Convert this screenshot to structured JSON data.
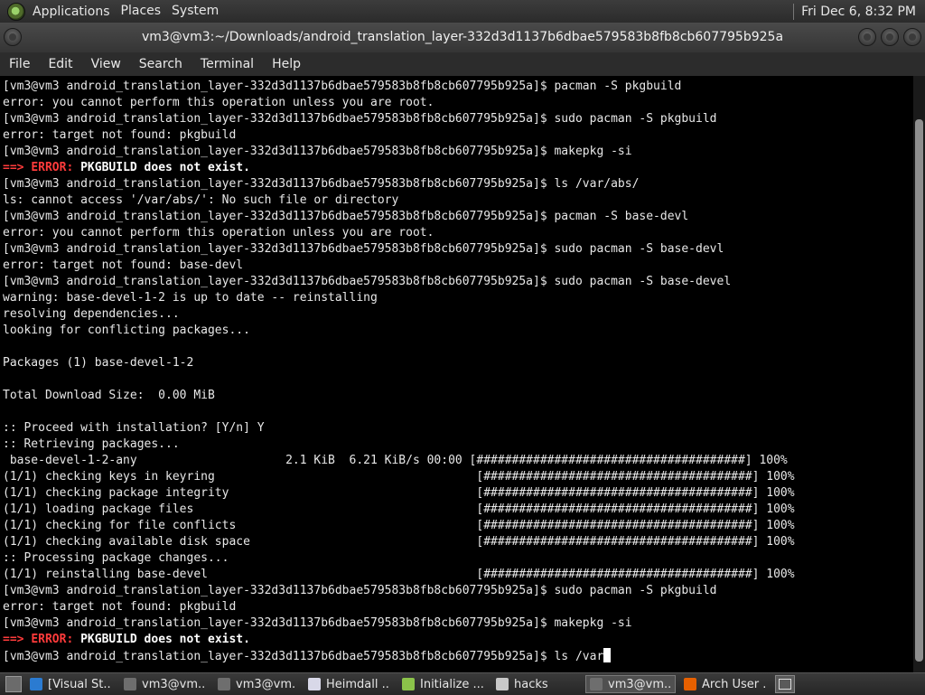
{
  "top_panel": {
    "menus": [
      "Applications",
      "Places",
      "System"
    ],
    "clock": "Fri Dec 6, 8:32 PM"
  },
  "window": {
    "title": "vm3@vm3:~/Downloads/android_translation_layer-332d3d1137b6dbae579583b8fb8cb607795b925a"
  },
  "menubar": [
    "File",
    "Edit",
    "View",
    "Search",
    "Terminal",
    "Help"
  ],
  "terminal": {
    "lines": [
      {
        "type": "plain",
        "text": "[vm3@vm3 android_translation_layer-332d3d1137b6dbae579583b8fb8cb607795b925a]$ pacman -S pkgbuild"
      },
      {
        "type": "plain",
        "text": "error: you cannot perform this operation unless you are root."
      },
      {
        "type": "plain",
        "text": "[vm3@vm3 android_translation_layer-332d3d1137b6dbae579583b8fb8cb607795b925a]$ sudo pacman -S pkgbuild"
      },
      {
        "type": "plain",
        "text": "error: target not found: pkgbuild"
      },
      {
        "type": "plain",
        "text": "[vm3@vm3 android_translation_layer-332d3d1137b6dbae579583b8fb8cb607795b925a]$ makepkg -si"
      },
      {
        "type": "error",
        "arrow": "==>",
        "label": "ERROR:",
        "text": "PKGBUILD does not exist."
      },
      {
        "type": "plain",
        "text": "[vm3@vm3 android_translation_layer-332d3d1137b6dbae579583b8fb8cb607795b925a]$ ls /var/abs/"
      },
      {
        "type": "plain",
        "text": "ls: cannot access '/var/abs/': No such file or directory"
      },
      {
        "type": "plain",
        "text": "[vm3@vm3 android_translation_layer-332d3d1137b6dbae579583b8fb8cb607795b925a]$ pacman -S base-devl"
      },
      {
        "type": "plain",
        "text": "error: you cannot perform this operation unless you are root."
      },
      {
        "type": "plain",
        "text": "[vm3@vm3 android_translation_layer-332d3d1137b6dbae579583b8fb8cb607795b925a]$ sudo pacman -S base-devl"
      },
      {
        "type": "plain",
        "text": "error: target not found: base-devl"
      },
      {
        "type": "plain",
        "text": "[vm3@vm3 android_translation_layer-332d3d1137b6dbae579583b8fb8cb607795b925a]$ sudo pacman -S base-devel"
      },
      {
        "type": "plain",
        "text": "warning: base-devel-1-2 is up to date -- reinstalling"
      },
      {
        "type": "plain",
        "text": "resolving dependencies..."
      },
      {
        "type": "plain",
        "text": "looking for conflicting packages..."
      },
      {
        "type": "plain",
        "text": ""
      },
      {
        "type": "plain",
        "text": "Packages (1) base-devel-1-2"
      },
      {
        "type": "plain",
        "text": ""
      },
      {
        "type": "plain",
        "text": "Total Download Size:  0.00 MiB"
      },
      {
        "type": "plain",
        "text": ""
      },
      {
        "type": "plain",
        "text": ":: Proceed with installation? [Y/n] Y"
      },
      {
        "type": "plain",
        "text": ":: Retrieving packages..."
      },
      {
        "type": "plain",
        "text": " base-devel-1-2-any                     2.1 KiB  6.21 KiB/s 00:00 [######################################] 100%"
      },
      {
        "type": "plain",
        "text": "(1/1) checking keys in keyring                                     [######################################] 100%"
      },
      {
        "type": "plain",
        "text": "(1/1) checking package integrity                                   [######################################] 100%"
      },
      {
        "type": "plain",
        "text": "(1/1) loading package files                                        [######################################] 100%"
      },
      {
        "type": "plain",
        "text": "(1/1) checking for file conflicts                                  [######################################] 100%"
      },
      {
        "type": "plain",
        "text": "(1/1) checking available disk space                                [######################################] 100%"
      },
      {
        "type": "plain",
        "text": ":: Processing package changes..."
      },
      {
        "type": "plain",
        "text": "(1/1) reinstalling base-devel                                      [######################################] 100%"
      },
      {
        "type": "plain",
        "text": "[vm3@vm3 android_translation_layer-332d3d1137b6dbae579583b8fb8cb607795b925a]$ sudo pacman -S pkgbuild"
      },
      {
        "type": "plain",
        "text": "error: target not found: pkgbuild"
      },
      {
        "type": "plain",
        "text": "[vm3@vm3 android_translation_layer-332d3d1137b6dbae579583b8fb8cb607795b925a]$ makepkg -si"
      },
      {
        "type": "error",
        "arrow": "==>",
        "label": "ERROR:",
        "text": "PKGBUILD does not exist."
      },
      {
        "type": "prompt",
        "text": "[vm3@vm3 android_translation_layer-332d3d1137b6dbae579583b8fb8cb607795b925a]$ ls /var"
      }
    ]
  },
  "taskbar": {
    "items": [
      {
        "label": "[Visual St...",
        "icon": "vscode-icon",
        "color": "#2b7bd1"
      },
      {
        "label": "vm3@vm...",
        "icon": "terminal-icon",
        "color": "#6e6e6e"
      },
      {
        "label": "vm3@vm...",
        "icon": "terminal-icon",
        "color": "#6e6e6e"
      },
      {
        "label": "Heimdall ...",
        "icon": "window-icon",
        "color": "#d8d8e8"
      },
      {
        "label": "Initialize ...",
        "icon": "android-icon",
        "color": "#8bc34a"
      },
      {
        "label": "hacks",
        "icon": "folder-icon",
        "color": "#c8c8c8"
      },
      {
        "label": "vm3@vm...",
        "icon": "terminal-icon",
        "color": "#6e6e6e",
        "active": true
      },
      {
        "label": "Arch User ...",
        "icon": "firefox-icon",
        "color": "#e66000"
      }
    ]
  }
}
